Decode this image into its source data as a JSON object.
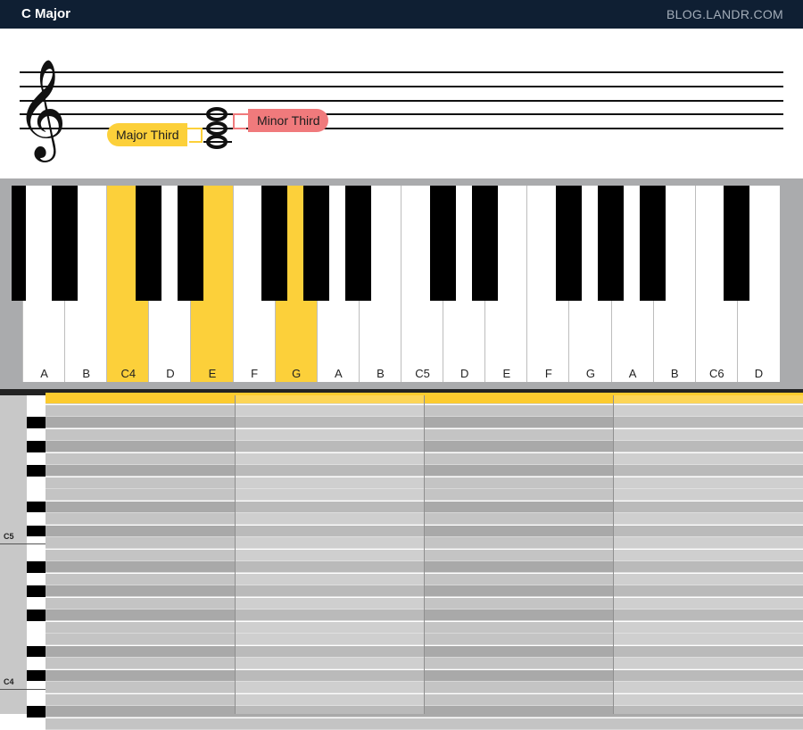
{
  "header": {
    "title": "C Major",
    "brand": "BLOG.LANDR.COM"
  },
  "staff": {
    "labels": {
      "major_third": "Major Third",
      "minor_third": "Minor Third"
    },
    "colors": {
      "major_third": "#fcd03a",
      "minor_third": "#f07a7c"
    }
  },
  "keyboard": {
    "keys": [
      {
        "label": "A",
        "on": false
      },
      {
        "label": "B",
        "on": false
      },
      {
        "label": "C4",
        "on": true
      },
      {
        "label": "D",
        "on": false
      },
      {
        "label": "E",
        "on": true
      },
      {
        "label": "F",
        "on": false
      },
      {
        "label": "G",
        "on": true
      },
      {
        "label": "A",
        "on": false
      },
      {
        "label": "B",
        "on": false
      },
      {
        "label": "C5",
        "on": false
      },
      {
        "label": "D",
        "on": false
      },
      {
        "label": "E",
        "on": false
      },
      {
        "label": "F",
        "on": false
      },
      {
        "label": "G",
        "on": false
      },
      {
        "label": "A",
        "on": false
      },
      {
        "label": "B",
        "on": false
      },
      {
        "label": "C6",
        "on": false
      },
      {
        "label": "D",
        "on": false
      }
    ],
    "highlight_color": "#fcd03a"
  },
  "piano_roll": {
    "octave_labels": [
      "C5",
      "C4"
    ],
    "highlighted_notes": [
      "C4",
      "E4",
      "G4"
    ]
  }
}
